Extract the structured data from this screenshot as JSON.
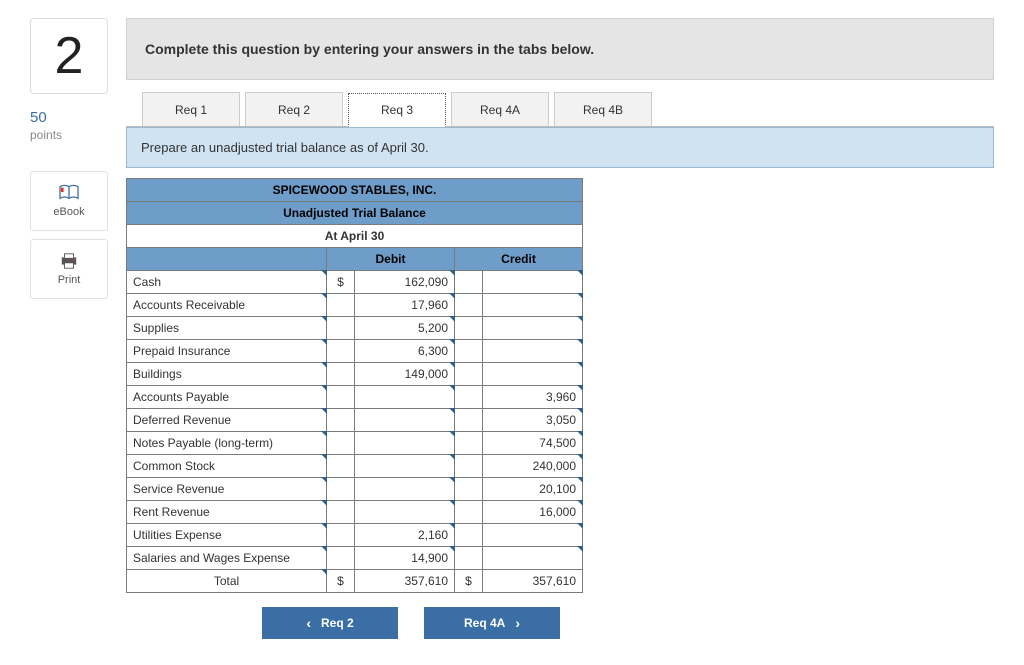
{
  "question_number": "2",
  "points_value": "50",
  "points_label": "points",
  "tools": {
    "ebook": "eBook",
    "print": "Print"
  },
  "instruction": "Complete this question by entering your answers in the tabs below.",
  "tabs": [
    "Req 1",
    "Req 2",
    "Req 3",
    "Req 4A",
    "Req 4B"
  ],
  "active_tab": 2,
  "prompt": "Prepare an unadjusted trial balance as of April 30.",
  "table": {
    "company": "SPICEWOOD STABLES, INC.",
    "title": "Unadjusted Trial Balance",
    "asof": "At April 30",
    "col_debit": "Debit",
    "col_credit": "Credit",
    "currency": "$",
    "rows": [
      {
        "acct": "Cash",
        "debit": "162,090",
        "credit": ""
      },
      {
        "acct": "Accounts Receivable",
        "debit": "17,960",
        "credit": ""
      },
      {
        "acct": "Supplies",
        "debit": "5,200",
        "credit": ""
      },
      {
        "acct": "Prepaid Insurance",
        "debit": "6,300",
        "credit": ""
      },
      {
        "acct": "Buildings",
        "debit": "149,000",
        "credit": ""
      },
      {
        "acct": "Accounts Payable",
        "debit": "",
        "credit": "3,960"
      },
      {
        "acct": "Deferred Revenue",
        "debit": "",
        "credit": "3,050"
      },
      {
        "acct": "Notes Payable (long-term)",
        "debit": "",
        "credit": "74,500"
      },
      {
        "acct": "Common Stock",
        "debit": "",
        "credit": "240,000"
      },
      {
        "acct": "Service Revenue",
        "debit": "",
        "credit": "20,100"
      },
      {
        "acct": "Rent Revenue",
        "debit": "",
        "credit": "16,000"
      },
      {
        "acct": "Utilities Expense",
        "debit": "2,160",
        "credit": ""
      },
      {
        "acct": "Salaries and Wages Expense",
        "debit": "14,900",
        "credit": ""
      }
    ],
    "total_label": "Total",
    "total_debit": "357,610",
    "total_credit": "357,610"
  },
  "nav": {
    "prev": "Req 2",
    "next": "Req 4A"
  }
}
